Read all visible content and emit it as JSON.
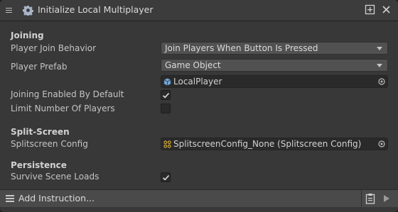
{
  "header": {
    "title": "Initialize Local Multiplayer"
  },
  "sections": {
    "joining": "Joining",
    "split_screen": "Split-Screen",
    "persistence": "Persistence"
  },
  "fields": {
    "player_join_behavior": {
      "label": "Player Join Behavior",
      "value": "Join Players When Button Is Pressed"
    },
    "player_prefab": {
      "label": "Player Prefab",
      "value": "Game Object",
      "object": "LocalPlayer"
    },
    "joining_enabled": {
      "label": "Joining Enabled By Default",
      "checked": true
    },
    "limit_players": {
      "label": "Limit Number Of Players",
      "checked": false
    },
    "splitscreen_config": {
      "label": "Splitscreen Config",
      "value": "SplitscreenConfig_None (Splitscreen Config)"
    },
    "survive_scene_loads": {
      "label": "Survive Scene Loads",
      "checked": true
    }
  },
  "footer": {
    "add_label": "Add Instruction..."
  },
  "colors": {
    "panel_bg": "#383838",
    "field_bg": "#2a2a2a",
    "dropdown_bg": "#515151",
    "prefab_icon": "#6fa7d8",
    "config_icon": "#e0b33a"
  }
}
